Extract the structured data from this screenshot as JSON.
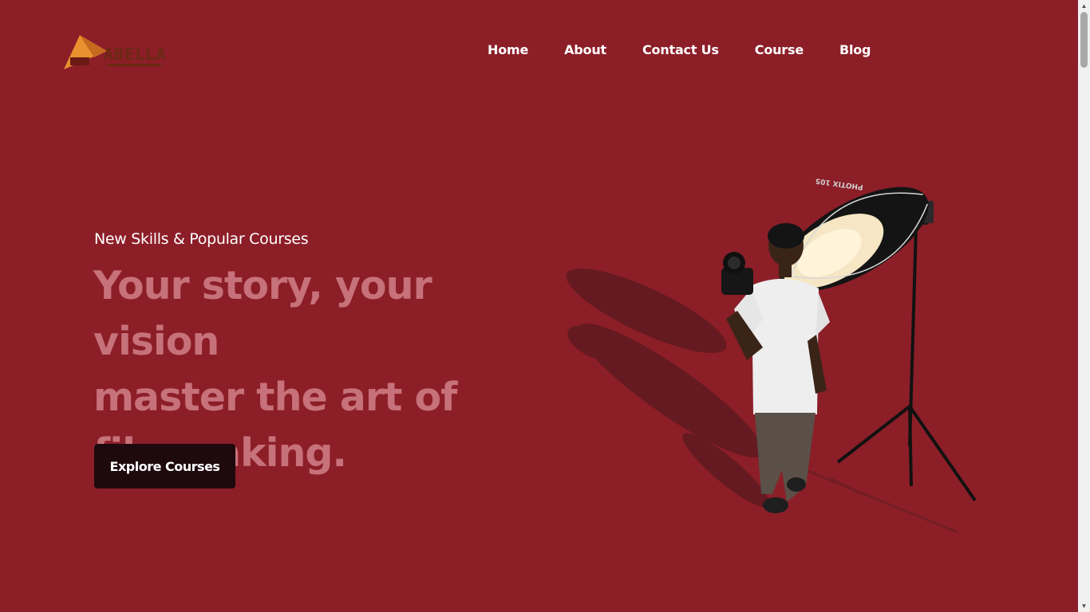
{
  "brand": {
    "logo_text": "ABELLA"
  },
  "nav": {
    "items": [
      {
        "label": "Home"
      },
      {
        "label": "About"
      },
      {
        "label": "Contact Us"
      },
      {
        "label": "Course"
      },
      {
        "label": "Blog"
      }
    ]
  },
  "hero": {
    "subtitle": "New Skills & Popular Courses",
    "headline_lines": [
      "Your story, your vision",
      "master the art of",
      "filmmaking."
    ],
    "cta_label": "Explore Courses",
    "softbox_text": "PHOTIX 105"
  },
  "colors": {
    "background": "#8c1e28",
    "headline": "#c7717a",
    "button": "#1e0a0e",
    "logo_orange": "#e8912e"
  },
  "icons": {
    "scroll_up": "triangle-up-icon",
    "scroll_down": "triangle-down-icon"
  }
}
